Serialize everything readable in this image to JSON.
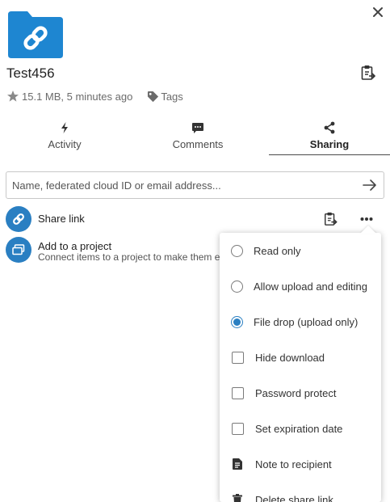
{
  "file": {
    "name": "Test456",
    "size_time": "15.1 MB, 5 minutes ago",
    "tags_label": "Tags",
    "folder_color": "#1e86d1"
  },
  "tabs": [
    {
      "label": "Activity",
      "icon": "activity-icon"
    },
    {
      "label": "Comments",
      "icon": "comments-icon"
    },
    {
      "label": "Sharing",
      "icon": "share-icon",
      "active": true
    }
  ],
  "share_input": {
    "placeholder": "Name, federated cloud ID or email address..."
  },
  "share_link": {
    "label": "Share link"
  },
  "project": {
    "title": "Add to a project",
    "description": "Connect items to a project to make them e"
  },
  "menu": {
    "items": [
      {
        "label": "Read only",
        "control": "radio",
        "checked": false
      },
      {
        "label": "Allow upload and editing",
        "control": "radio",
        "checked": false
      },
      {
        "label": "File drop (upload only)",
        "control": "radio",
        "checked": true
      },
      {
        "label": "Hide download",
        "control": "checkbox",
        "checked": false
      },
      {
        "label": "Password protect",
        "control": "checkbox",
        "checked": false
      },
      {
        "label": "Set expiration date",
        "control": "checkbox",
        "checked": false
      },
      {
        "label": "Note to recipient",
        "control": "icon",
        "icon": "note-icon"
      },
      {
        "label": "Delete share link",
        "control": "icon",
        "icon": "trash-icon"
      }
    ]
  },
  "colors": {
    "accent": "#2a7fc2",
    "folder": "#1e86d1"
  }
}
